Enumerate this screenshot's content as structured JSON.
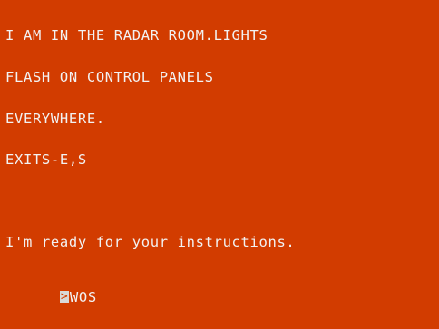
{
  "screen": {
    "background": "#d23c00",
    "text_color": "#f2f2f2"
  },
  "description_lines": [
    "I AM IN THE RADAR ROOM.LIGHTS",
    "FLASH ON CONTROL PANELS",
    "EVERYWHERE.",
    "EXITS-E,S"
  ],
  "prompt_message": "I'm ready for your instructions.",
  "prompt": {
    "cursor_symbol": ">",
    "input_text": "WOS"
  }
}
